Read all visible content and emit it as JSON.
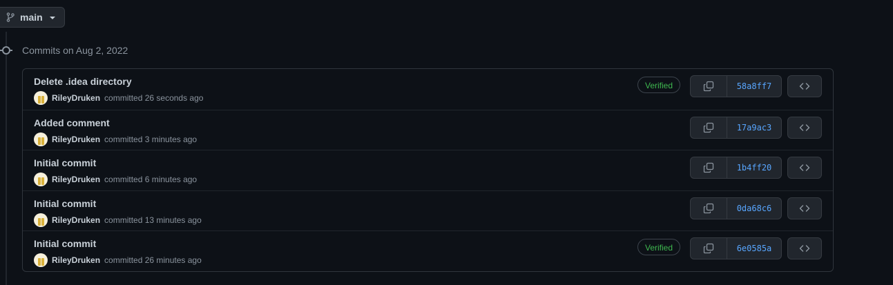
{
  "branch": {
    "label": "main",
    "icon": "git-branch-icon"
  },
  "group": {
    "heading": "Commits on Aug 2, 2022"
  },
  "commits": [
    {
      "title": "Delete .idea directory",
      "author": "RileyDruken",
      "committed_text": "committed 26 seconds ago",
      "verified": "Verified",
      "sha": "58a8ff7"
    },
    {
      "title": "Added comment",
      "author": "RileyDruken",
      "committed_text": "committed 3 minutes ago",
      "verified": "",
      "sha": "17a9ac3"
    },
    {
      "title": "Initial commit",
      "author": "RileyDruken",
      "committed_text": "committed 6 minutes ago",
      "verified": "",
      "sha": "1b4ff20"
    },
    {
      "title": "Initial commit",
      "author": "RileyDruken",
      "committed_text": "committed 13 minutes ago",
      "verified": "",
      "sha": "0da68c6"
    },
    {
      "title": "Initial commit",
      "author": "RileyDruken",
      "committed_text": "committed 26 minutes ago",
      "verified": "Verified",
      "sha": "6e0585a"
    }
  ],
  "colors": {
    "background": "#0d1117",
    "verified": "#3fb950",
    "sha_link": "#58a6ff",
    "border": "#30363d"
  }
}
